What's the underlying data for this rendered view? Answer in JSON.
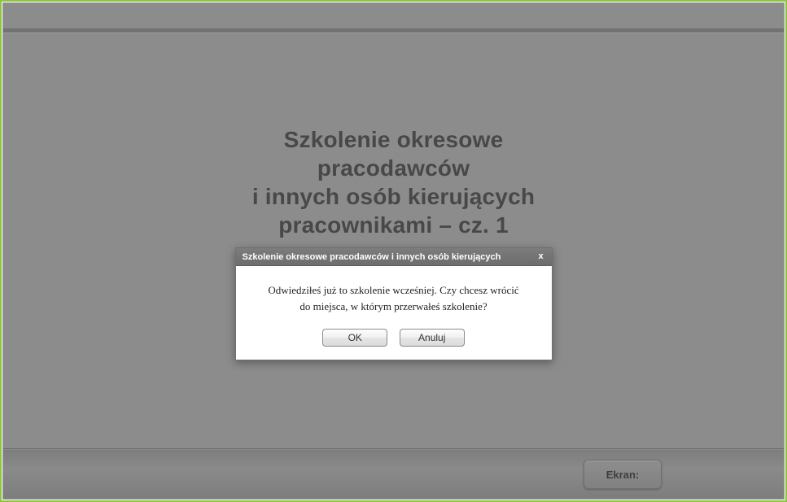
{
  "title": {
    "line1": "Szkolenie okresowe",
    "line2": "pracodawców",
    "line3": "i innych osób kierujących",
    "line4": "pracownikami – cz. 1"
  },
  "footer": {
    "ekran_label": "Ekran:"
  },
  "dialog": {
    "title": "Szkolenie okresowe pracodawców i innych osób kierujących",
    "message_line1": "Odwiedziłeś już to szkolenie wcześniej. Czy chcesz wrócić",
    "message_line2": "do miejsca, w którym przerwałeś szkolenie?",
    "ok_label": "OK",
    "cancel_label": "Anuluj",
    "close_glyph": "x"
  }
}
